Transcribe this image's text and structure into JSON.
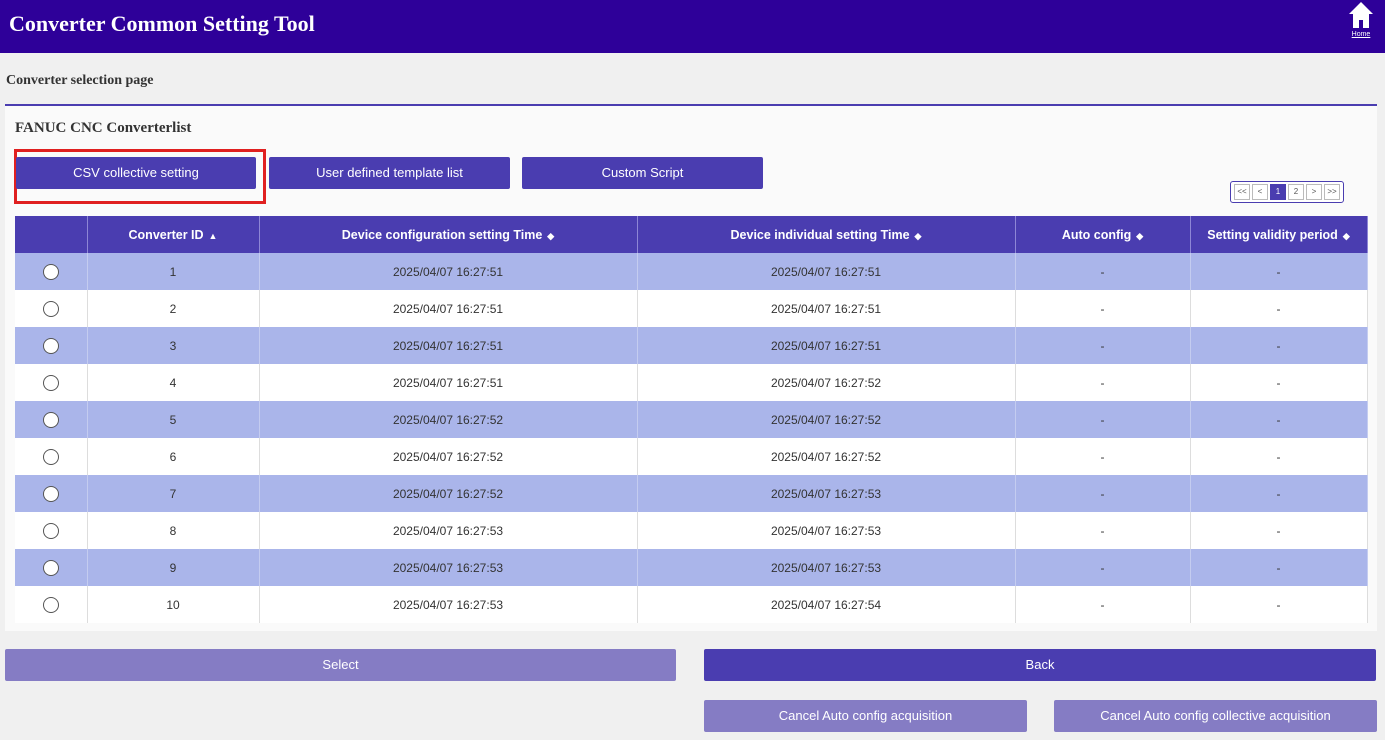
{
  "header": {
    "title": "Converter Common Setting Tool",
    "home_label": "Home",
    "bg_color": "#2e0099"
  },
  "page": {
    "subtitle": "Converter selection page"
  },
  "panel": {
    "title": "FANUC CNC Converterlist",
    "buttons": {
      "csv": "CSV collective setting",
      "template": "User defined template list",
      "script": "Custom Script"
    }
  },
  "pagination": {
    "first": "<<",
    "prev": "<",
    "pages": [
      "1",
      "2"
    ],
    "current": "1",
    "next": ">",
    "last": ">>"
  },
  "table": {
    "columns": [
      "",
      "Converter ID",
      "Device configuration setting Time",
      "Device individual setting Time",
      "Auto config",
      "Setting validity period"
    ],
    "sort_icons": [
      "",
      "▲",
      "◆",
      "◆",
      "◆",
      "◆"
    ],
    "rows": [
      {
        "id": "1",
        "config_time": "2025/04/07 16:27:51",
        "individual_time": "2025/04/07 16:27:51",
        "auto_config": "-",
        "validity": "-"
      },
      {
        "id": "2",
        "config_time": "2025/04/07 16:27:51",
        "individual_time": "2025/04/07 16:27:51",
        "auto_config": "-",
        "validity": "-"
      },
      {
        "id": "3",
        "config_time": "2025/04/07 16:27:51",
        "individual_time": "2025/04/07 16:27:51",
        "auto_config": "-",
        "validity": "-"
      },
      {
        "id": "4",
        "config_time": "2025/04/07 16:27:51",
        "individual_time": "2025/04/07 16:27:52",
        "auto_config": "-",
        "validity": "-"
      },
      {
        "id": "5",
        "config_time": "2025/04/07 16:27:52",
        "individual_time": "2025/04/07 16:27:52",
        "auto_config": "-",
        "validity": "-"
      },
      {
        "id": "6",
        "config_time": "2025/04/07 16:27:52",
        "individual_time": "2025/04/07 16:27:52",
        "auto_config": "-",
        "validity": "-"
      },
      {
        "id": "7",
        "config_time": "2025/04/07 16:27:52",
        "individual_time": "2025/04/07 16:27:53",
        "auto_config": "-",
        "validity": "-"
      },
      {
        "id": "8",
        "config_time": "2025/04/07 16:27:53",
        "individual_time": "2025/04/07 16:27:53",
        "auto_config": "-",
        "validity": "-"
      },
      {
        "id": "9",
        "config_time": "2025/04/07 16:27:53",
        "individual_time": "2025/04/07 16:27:53",
        "auto_config": "-",
        "validity": "-"
      },
      {
        "id": "10",
        "config_time": "2025/04/07 16:27:53",
        "individual_time": "2025/04/07 16:27:54",
        "auto_config": "-",
        "validity": "-"
      }
    ]
  },
  "footer": {
    "select": "Select",
    "back": "Back",
    "cancel_auto": "Cancel Auto config acquisition",
    "cancel_collective": "Cancel Auto config collective acquisition"
  },
  "colors": {
    "accent": "#4a3db0",
    "row_alt": "#aab5ea",
    "highlight_border": "#e02020",
    "disabled_button": "#857cc4"
  }
}
